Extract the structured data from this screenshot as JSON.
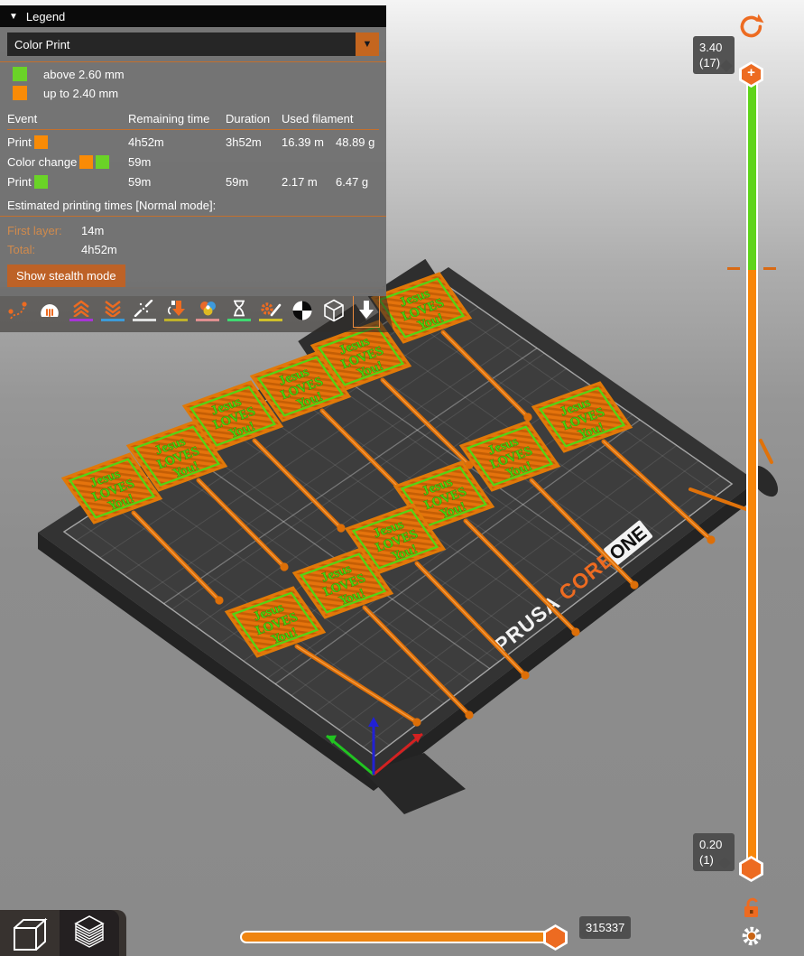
{
  "legend": {
    "title": "Legend",
    "view_type_value": "Color Print",
    "height_items": [
      {
        "color": "#6ad327",
        "label": "above 2.60 mm"
      },
      {
        "color": "#f98b06",
        "label": "up to 2.40 mm"
      }
    ],
    "table": {
      "headers": [
        "Event",
        "Remaining time",
        "Duration",
        "Used filament"
      ],
      "rows": [
        {
          "event": "Print",
          "swatches": [
            "#f98b06"
          ],
          "remaining": "4h52m",
          "duration": "3h52m",
          "filament_m": "16.39 m",
          "filament_g": "48.89 g"
        },
        {
          "event": "Color change",
          "swatches": [
            "#f98b06",
            "#6ad327"
          ],
          "remaining": "59m",
          "duration": "",
          "filament_m": "",
          "filament_g": ""
        },
        {
          "event": "Print",
          "swatches": [
            "#6ad327"
          ],
          "remaining": "59m",
          "duration": "59m",
          "filament_m": "2.17 m",
          "filament_g": "6.47 g"
        }
      ]
    },
    "estimated_title": "Estimated printing times [Normal mode]:",
    "first_layer_label": "First layer:",
    "first_layer_value": "14m",
    "total_label": "Total:",
    "total_value": "4h52m",
    "stealth_button": "Show stealth mode",
    "toolbar_icons": [
      "travel-moves",
      "wipe",
      "retractions",
      "deretractions",
      "seams",
      "tool-changes",
      "color-changes",
      "pause-prints",
      "custom-gcode",
      "center-of-gravity",
      "shells",
      "tool-marker"
    ]
  },
  "vertical_slider": {
    "top_tooltip_value": "3.40",
    "top_tooltip_layer": "(17)",
    "bottom_tooltip_value": "0.20",
    "bottom_tooltip_layer": "(1)"
  },
  "horizontal_slider": {
    "tooltip": "315337"
  },
  "scene": {
    "sign_lines": [
      "Jesus",
      "LOVES",
      "You!"
    ],
    "bed_brand": {
      "part1": "PRUSA",
      "part2": "CORE",
      "part3": "ONE"
    }
  },
  "colors": {
    "accent_orange": "#ED6B21",
    "filament_orange": "#f98b06",
    "filament_green": "#6ad327"
  }
}
